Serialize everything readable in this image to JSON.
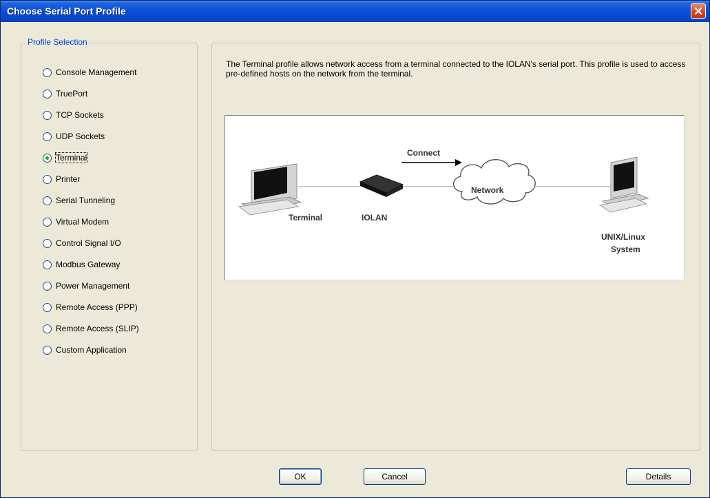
{
  "window": {
    "title": "Choose Serial Port Profile"
  },
  "profile_group": {
    "legend": "Profile Selection",
    "selected": "Terminal",
    "options": [
      "Console Management",
      "TruePort",
      "TCP Sockets",
      "UDP Sockets",
      "Terminal",
      "Printer",
      "Serial Tunneling",
      "Virtual Modem",
      "Control Signal I/O",
      "Modbus Gateway",
      "Power Management",
      "Remote Access (PPP)",
      "Remote Access (SLIP)",
      "Custom Application"
    ]
  },
  "description": {
    "text": "The Terminal profile allows network access from a terminal connected to the IOLAN's serial port. This profile is used to access pre-defined hosts on the network from the terminal."
  },
  "diagram": {
    "connect_label": "Connect",
    "network_label": "Network",
    "terminal_label": "Terminal",
    "iolan_label": "IOLAN",
    "unix_label_line1": "UNIX/Linux",
    "unix_label_line2": "System"
  },
  "buttons": {
    "ok": "OK",
    "cancel": "Cancel",
    "details": "Details"
  },
  "colors": {
    "titlebar": "#0a47c9",
    "dialog_bg": "#ece9d8",
    "legend_text": "#0046d5",
    "close_button": "#d2461f",
    "radio_selected_dot": "#21a121"
  },
  "icons": {
    "close": "close-x-icon",
    "terminal": "terminal-computer-icon",
    "iolan": "iolan-device-icon",
    "network": "network-cloud-icon",
    "unix": "unix-workstation-icon",
    "connect_arrow": "arrow-right-icon"
  }
}
